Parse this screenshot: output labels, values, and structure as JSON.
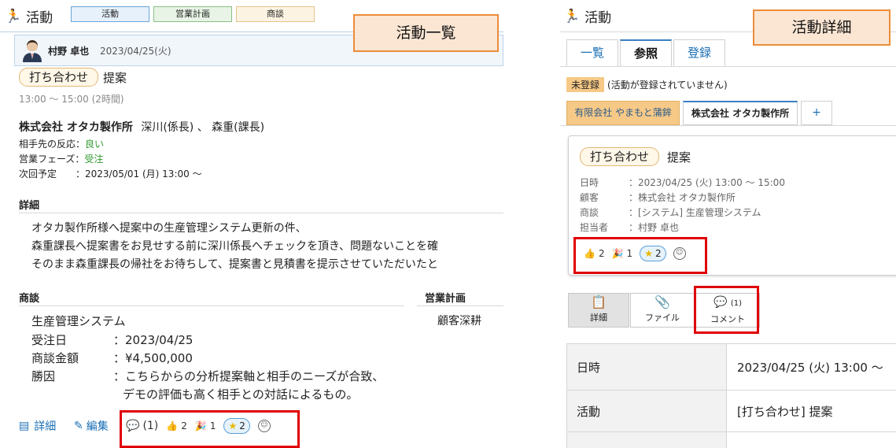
{
  "left": {
    "app_title": "活動",
    "chips": [
      {
        "label": "活動",
        "bg": "#e6f1fb",
        "border": "#6aa6d9"
      },
      {
        "label": "営業計画",
        "bg": "#e8f4e6",
        "border": "#8bbf86"
      },
      {
        "label": "商談",
        "bg": "#fdf3e2",
        "border": "#e7c48a"
      }
    ],
    "callout": "活動一覧",
    "user_name": "村野 卓也",
    "date": "2023/04/25(火)",
    "activity_type": "打ち合わせ",
    "activity_title": "提案",
    "time": "13:00 ～ 15:00 (2時間)",
    "company": "株式会社 オタカ製作所",
    "contacts": "深川(係長) 、 森重(課長)",
    "reaction_label": "相手先の反応：",
    "reaction_value": "良い",
    "phase_label": "営業フェーズ：",
    "phase_value": "受注",
    "next_label": "次回予定　　：",
    "next_value": "2023/05/01 (月) 13:00 ～",
    "detail_title": "詳細",
    "detail_lines": [
      "オタカ製作所様へ提案中の生産管理システム更新の件、",
      "森重課長へ提案書をお見せする前に深川係長へチェックを頂き、問題ないことを確",
      "そのまま森重課長の帰社をお待ちして、提案書と見積書を提示させていただいたと"
    ],
    "deal_title": "商談",
    "plan_title": "営業計画",
    "deal_name": "生産管理システム",
    "plan_value": "顧客深耕",
    "order_date_label": "受注日",
    "order_date_value": "：2023/04/25",
    "amount_label": "商談金額",
    "amount_value": "：¥4,500,000",
    "reason_label": "勝因",
    "reason_line1": "：こちらからの分析提案軸と相手のニーズが合致、",
    "reason_line2": "デモの評価も高く相手との対話によるもの。",
    "link_detail": "詳細",
    "link_edit": "編集",
    "comment_count": "(1)",
    "thumbs_count": "2",
    "party_count": "1",
    "star_count": "2"
  },
  "right": {
    "app_title": "活動",
    "callout": "活動詳細",
    "tabs": [
      "一覧",
      "参照",
      "登録"
    ],
    "unregistered_badge": "未登録",
    "unregistered_note": "(活動が登録されていません)",
    "company_tabs": [
      "有限会社 やまもと蒲鉾",
      "株式会社 オタカ製作所"
    ],
    "add_tab": "+",
    "activity_type": "打ち合わせ",
    "activity_title": "提案",
    "fields": [
      {
        "key": "日時",
        "value": "：2023/04/25 (火) 13:00 ～ 15:00",
        "link": false
      },
      {
        "key": "顧客",
        "value": "：株式会社 オタカ製作所",
        "link": true
      },
      {
        "key": "商談",
        "value": "：[システム] 生産管理システム",
        "link": true
      },
      {
        "key": "担当者",
        "value": "：村野 卓也",
        "link": false
      }
    ],
    "thumbs_count": "2",
    "party_count": "1",
    "star_count": "2",
    "tool_tabs": [
      {
        "label": "詳細",
        "icon": "clipboard-icon"
      },
      {
        "label": "ファイル",
        "icon": "paperclip-icon"
      },
      {
        "label": "コメント",
        "icon": "comment-icon",
        "count": "(1)"
      }
    ],
    "table": [
      {
        "key": "日時",
        "value": "2023/04/25 (火) 13:00 ～"
      },
      {
        "key": "活動",
        "value": "[打ち合わせ] 提案"
      }
    ]
  }
}
